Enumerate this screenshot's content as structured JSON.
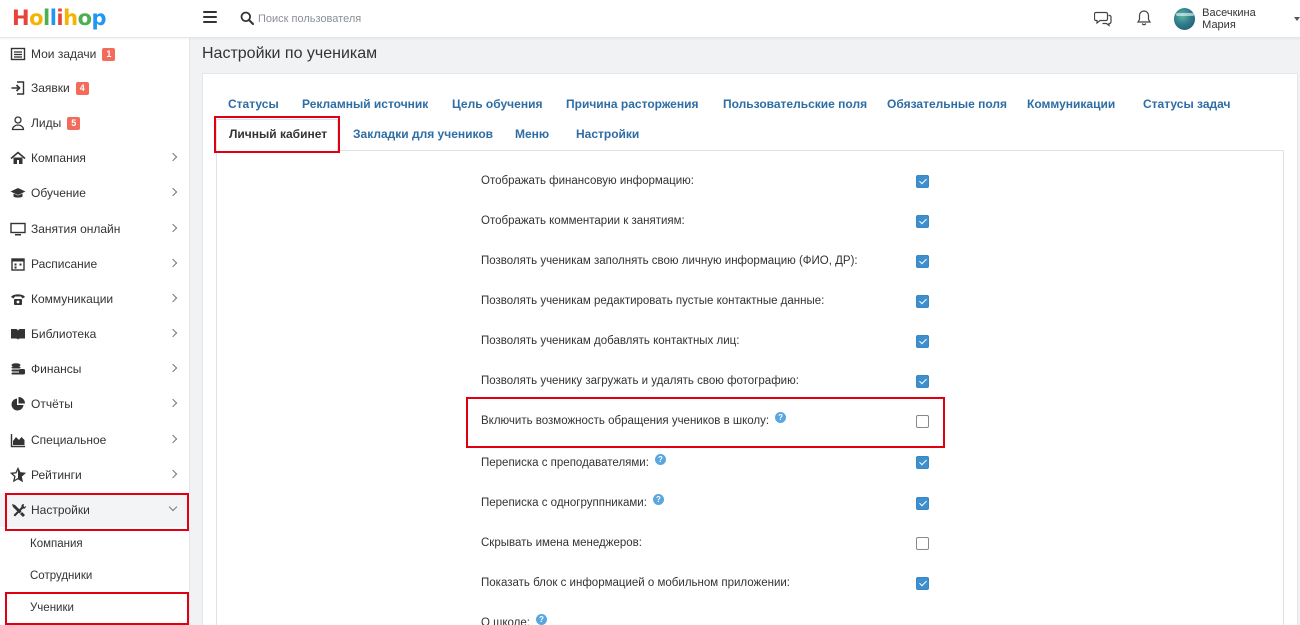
{
  "header": {
    "logo_letters": [
      {
        "ch": "H",
        "color": "#e8433a"
      },
      {
        "ch": "o",
        "color": "#f4b400"
      },
      {
        "ch": "l",
        "color": "#4caf50"
      },
      {
        "ch": "l",
        "color": "#2196f3"
      },
      {
        "ch": "i",
        "color": "#e8433a"
      },
      {
        "ch": "h",
        "color": "#f4b400"
      },
      {
        "ch": "o",
        "color": "#4caf50"
      },
      {
        "ch": "p",
        "color": "#2196f3"
      }
    ],
    "search_placeholder": "Поиск пользователя",
    "user_name": "Васечкина Мария"
  },
  "sidebar": {
    "items": [
      {
        "label": "Мои задачи",
        "icon": "list-icon",
        "badge": "1"
      },
      {
        "label": "Заявки",
        "icon": "sign-in-icon",
        "badge": "4"
      },
      {
        "label": "Лиды",
        "icon": "user-icon",
        "badge": "5"
      },
      {
        "label": "Компания",
        "icon": "home-icon"
      },
      {
        "label": "Обучение",
        "icon": "graduation-cap-icon"
      },
      {
        "label": "Занятия онлайн",
        "icon": "monitor-icon"
      },
      {
        "label": "Расписание",
        "icon": "calendar-icon"
      },
      {
        "label": "Коммуникации",
        "icon": "phone-icon"
      },
      {
        "label": "Библиотека",
        "icon": "book-icon"
      },
      {
        "label": "Финансы",
        "icon": "coins-icon"
      },
      {
        "label": "Отчёты",
        "icon": "pie-chart-icon"
      },
      {
        "label": "Специальное",
        "icon": "area-chart-icon"
      },
      {
        "label": "Рейтинги",
        "icon": "star-icon"
      },
      {
        "label": "Настройки",
        "icon": "tools-icon"
      }
    ],
    "subitems": [
      {
        "label": "Компания"
      },
      {
        "label": "Сотрудники"
      },
      {
        "label": "Ученики"
      }
    ]
  },
  "page": {
    "title": "Настройки по ученикам"
  },
  "tabs": [
    {
      "label": "Статусы"
    },
    {
      "label": "Рекламный источник"
    },
    {
      "label": "Цель обучения"
    },
    {
      "label": "Причина расторжения"
    },
    {
      "label": "Пользовательские поля"
    },
    {
      "label": "Обязательные поля"
    },
    {
      "label": "Коммуникации"
    },
    {
      "label": "Статусы задач"
    },
    {
      "label": "Личный кабинет"
    },
    {
      "label": "Закладки для учеников"
    },
    {
      "label": "Меню"
    },
    {
      "label": "Настройки"
    }
  ],
  "options": [
    {
      "label": "Отображать финансовую информацию:",
      "checked": true,
      "help": false
    },
    {
      "label": "Отображать комментарии к занятиям:",
      "checked": true,
      "help": false
    },
    {
      "label": "Позволять ученикам заполнять свою личную информацию (ФИО, ДР):",
      "checked": true,
      "help": false
    },
    {
      "label": "Позволять ученикам редактировать пустые контактные данные:",
      "checked": true,
      "help": false
    },
    {
      "label": "Позволять ученикам добавлять контактных лиц:",
      "checked": true,
      "help": false
    },
    {
      "label": "Позволять ученику загружать и удалять свою фотографию:",
      "checked": true,
      "help": false
    },
    {
      "label": "Включить возможность обращения учеников в школу:",
      "checked": false,
      "help": true
    },
    {
      "label": "Переписка с преподавателями:",
      "checked": true,
      "help": true
    },
    {
      "label": "Переписка с одногруппниками:",
      "checked": true,
      "help": true
    },
    {
      "label": "Скрывать имена менеджеров:",
      "checked": false,
      "help": false
    },
    {
      "label": "Показать блок с информацией о мобильном приложении:",
      "checked": true,
      "help": false
    },
    {
      "label": "О школе:",
      "checked": null,
      "help": true
    }
  ],
  "help_glyph": "?"
}
